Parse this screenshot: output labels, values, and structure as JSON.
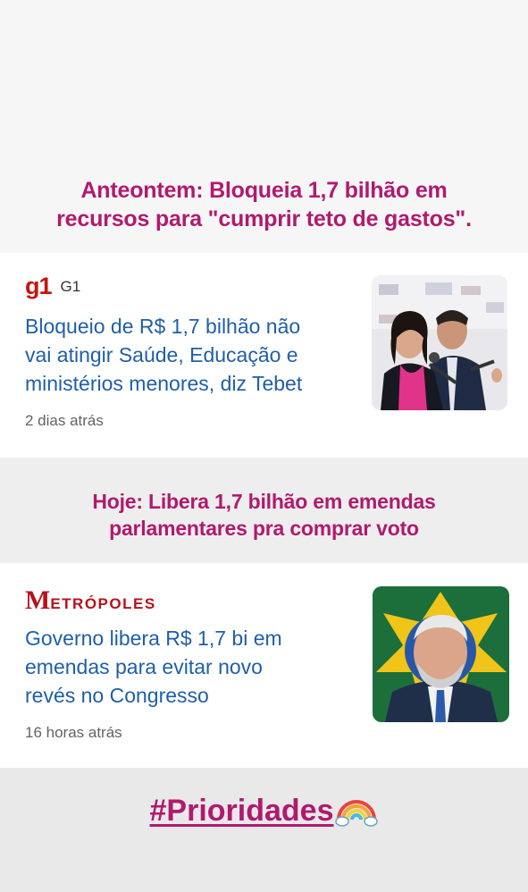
{
  "headline1": [
    "Anteontem: Bloqueia 1,7 bilhão em",
    "recursos para \"cumprir teto de gastos\"."
  ],
  "card1": {
    "logo_text": "g1",
    "source_name": "G1",
    "title": [
      "Bloqueio de R$ 1,7 bilhão não",
      "vai atingir Saúde, Educação e",
      "ministérios menores, diz Tebet"
    ],
    "time": "2 dias atrás"
  },
  "headline2": [
    "Hoje: Libera 1,7 bilhão em emendas",
    "parlamentares pra comprar voto"
  ],
  "card2": {
    "logo_m": "M",
    "logo_rest": "ETRÓPOLES",
    "title": [
      "Governo libera R$ 1,7 bi em",
      "emendas para evitar novo",
      "revés no Congresso"
    ],
    "time": "16 horas atrás"
  },
  "hashtag": "#Prioridades",
  "colors": {
    "accent": "#b01a6e",
    "link": "#1f5fa8",
    "g1": "#c4170c",
    "metropoles": "#b5121b"
  }
}
